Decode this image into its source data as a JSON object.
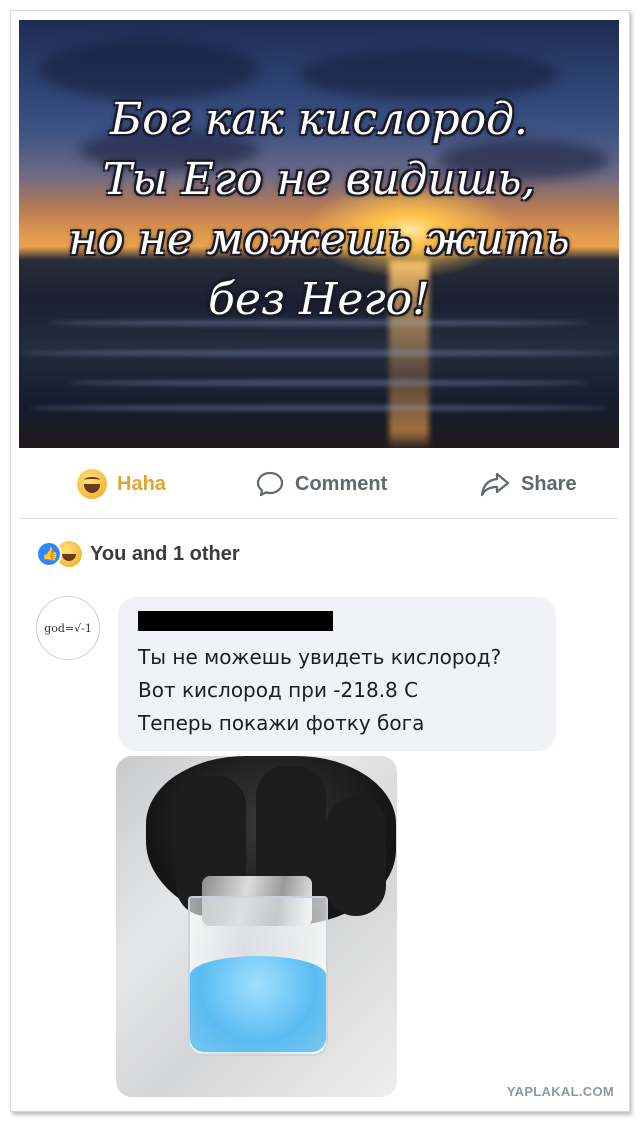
{
  "post": {
    "image_quote": [
      "Бог как кислород.",
      "Ты Его не видишь,",
      "но не можешь жить",
      "без Него!"
    ]
  },
  "actions": {
    "haha_label": "Haha",
    "comment_label": "Comment",
    "share_label": "Share",
    "haha_color": "#e0a52e"
  },
  "reactions": {
    "summary": "You and 1 other",
    "icons": [
      "like-icon",
      "haha-icon"
    ]
  },
  "comment": {
    "avatar_text": "god=√-1",
    "lines": [
      "Ты не можешь увидеть кислород?",
      "Вот кислород при -218.8 С",
      "Теперь покажи фотку бога"
    ]
  },
  "watermark": "YAPLAKAL.COM"
}
